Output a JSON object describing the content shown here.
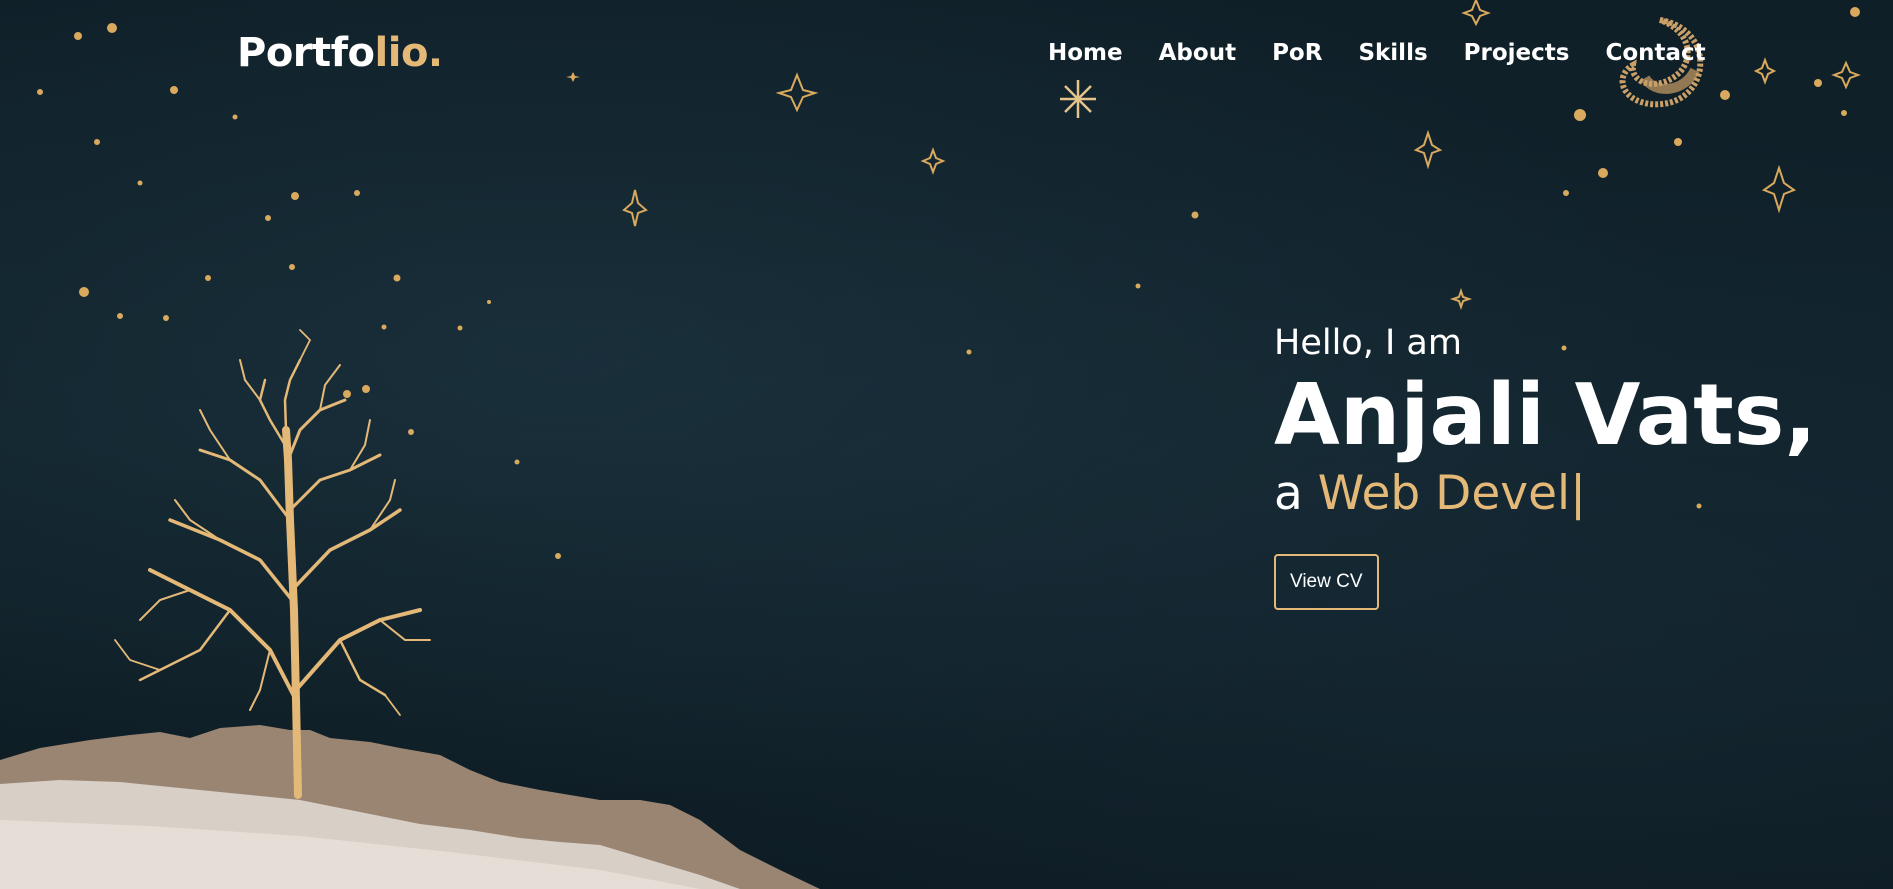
{
  "navbar": {
    "logo_main": "Portfo",
    "logo_accent": "lio.",
    "links": [
      {
        "label": "Home"
      },
      {
        "label": "About"
      },
      {
        "label": "PoR"
      },
      {
        "label": "Skills"
      },
      {
        "label": "Projects"
      },
      {
        "label": "Contact"
      }
    ]
  },
  "hero": {
    "greeting": "Hello, I am",
    "name": "Anjali Vats,",
    "role_prefix": "a ",
    "role_typed": "Web Devel",
    "cursor": "|",
    "cv_button_label": "View CV"
  },
  "colors": {
    "background": "#0f1e26",
    "accent_gold": "#e4b978",
    "text": "#ffffff"
  },
  "icons": {
    "moon": "crescent-moon-icon",
    "stars": "sparkle-star-icon",
    "tree": "gold-tree-illustration",
    "hill": "glitter-hill-illustration"
  }
}
